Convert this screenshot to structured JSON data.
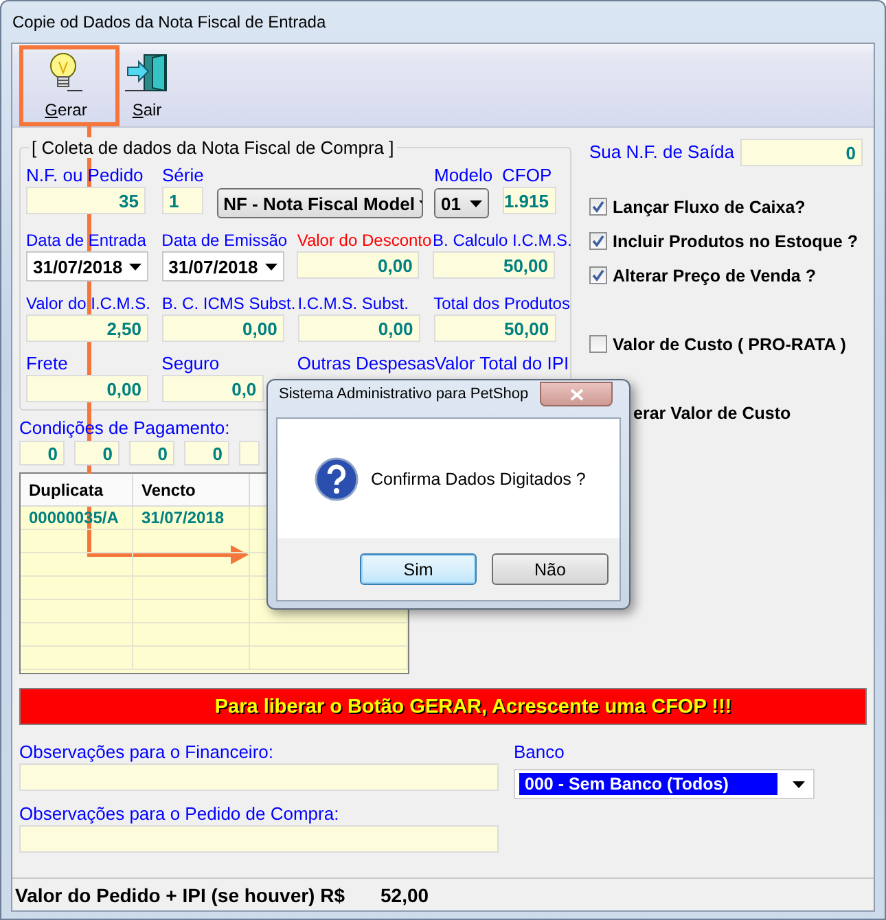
{
  "window": {
    "title": "Copie od Dados da Nota Fiscal de Entrada"
  },
  "toolbar": [
    {
      "label": "Gerar",
      "kind": "bulb"
    },
    {
      "label": "Sair",
      "kind": "exit"
    }
  ],
  "group": {
    "title": "[ Coleta de dados da Nota Fiscal de Compra ]",
    "rows": [
      [
        {
          "kind": "number",
          "label": "N.F. ou Pedido",
          "value": "35",
          "alert": false
        },
        {
          "kind": "text",
          "label": "Série",
          "value": "1",
          "alert": false
        },
        {
          "kind": "select",
          "value": "NF - Nota Fiscal Model"
        },
        {
          "kind": "select",
          "label": "Modelo",
          "value": "01",
          "alert": false
        },
        {
          "kind": "number",
          "label": "CFOP",
          "value": "1.915",
          "alert": false
        }
      ],
      [
        {
          "kind": "date",
          "label": "Data de Entrada",
          "value": "31/07/2018",
          "alert": false
        },
        {
          "kind": "date",
          "label": "Data de Emissão",
          "value": "31/07/2018",
          "alert": false
        },
        {
          "kind": "number",
          "label": "Valor do Desconto",
          "value": "0,00",
          "alert": true
        },
        {
          "kind": "number",
          "label": "B. Calculo I.C.M.S.",
          "value": "50,00",
          "alert": false
        }
      ],
      [
        {
          "kind": "number",
          "label": "Valor do I.C.M.S.",
          "value": "2,50",
          "alert": false
        },
        {
          "kind": "number",
          "label": "B. C. ICMS Subst.",
          "value": "0,00",
          "alert": false
        },
        {
          "kind": "number",
          "label": "I.C.M.S. Subst.",
          "value": "0,00",
          "alert": false
        },
        {
          "kind": "number",
          "label": "Total dos Produtos",
          "value": "50,00",
          "alert": false
        }
      ],
      [
        {
          "kind": "number",
          "label": "Frete",
          "value": "0,00",
          "alert": false
        },
        {
          "kind": "number",
          "label": "Seguro",
          "value": "0,0",
          "alert": false
        },
        {
          "kind": "label",
          "label": "Outras Despesas",
          "alert": false
        },
        {
          "kind": "label",
          "label": "Valor Total do IPI",
          "alert": false
        }
      ]
    ]
  },
  "payment": {
    "label": "Condições de Pagamento:",
    "fields": [
      "0",
      "0",
      "0",
      "0"
    ]
  },
  "table": {
    "columns": [
      "Duplicata",
      "Vencto"
    ],
    "rows": [
      [
        "00000035/A",
        "31/07/2018"
      ]
    ]
  },
  "nf_saida": {
    "label": "Sua N.F. de Saída",
    "value": "0"
  },
  "options": [
    {
      "label": "Lançar Fluxo de Caixa?",
      "checked": true
    },
    {
      "label": "Incluir Produtos no Estoque ?",
      "checked": true
    },
    {
      "label": "Alterar Preço de Venda ?",
      "checked": true
    },
    {
      "label": "Valor de Custo ( PRO-RATA )",
      "checked": false
    }
  ],
  "partial_option": "erar Valor de Custo",
  "warning": "Para liberar o Botão GERAR, Acrescente uma CFOP !!!",
  "notes": [
    {
      "label": "Observações para o Financeiro:"
    },
    {
      "label": "Observações para o Pedido de Compra:"
    }
  ],
  "bank": {
    "label": "Banco",
    "value": "000 - Sem Banco (Todos)"
  },
  "footer": {
    "label": "Valor do Pedido + IPI (se houver) R$",
    "value": "52,00"
  },
  "dialog": {
    "title": "Sistema Administrativo para PetShop",
    "message": "Confirma Dados Digitados ?",
    "buttons": [
      {
        "label": "Sim",
        "selected": true
      },
      {
        "label": "Não",
        "selected": false
      }
    ]
  }
}
